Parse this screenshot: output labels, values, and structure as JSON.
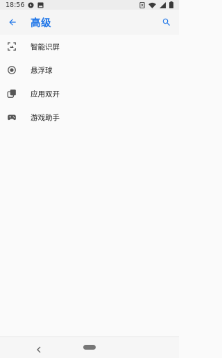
{
  "status_bar": {
    "time": "18:56"
  },
  "app_bar": {
    "title": "高级"
  },
  "items": [
    {
      "label": "智能识屏",
      "icon": "screen-recognition-icon"
    },
    {
      "label": "悬浮球",
      "icon": "floating-ball-icon"
    },
    {
      "label": "应用双开",
      "icon": "dual-apps-icon"
    },
    {
      "label": "游戏助手",
      "icon": "gamepad-icon"
    }
  ],
  "colors": {
    "accent": "#1a73e8",
    "icon": "#555555",
    "background": "#fafafa"
  }
}
